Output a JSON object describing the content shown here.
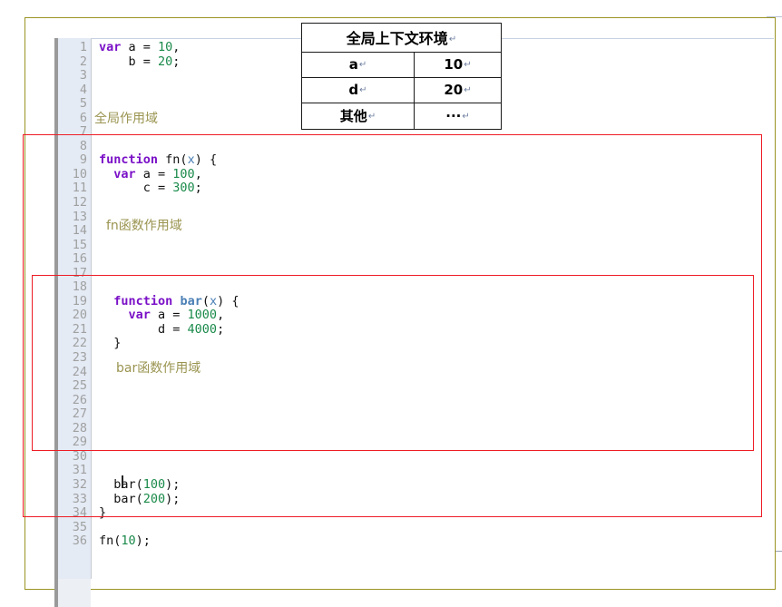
{
  "document": {
    "page_border_color": "#9a9424",
    "background": "#ffffff"
  },
  "editor": {
    "gutter": {
      "line_numbers": "1\n2\n3\n4\n5\n6\n7\n8\n9\n10\n11\n12\n13\n14\n15\n16\n17\n18\n19\n20\n21\n22\n23\n24\n25\n26\n27\n28\n29\n30\n31\n32\n33\n34\n35\n36",
      "first_line": 1,
      "last_line": 36,
      "background": "#e4ebf5",
      "text_color": "#a0a0a0"
    },
    "caret_line": 31,
    "syntax_colors": {
      "keyword": "#7a10c7",
      "number": "#1a8a4a",
      "function_name": "#4a7fb5",
      "parameter": "#4a7fb5",
      "plain": "#111111"
    },
    "lines": [
      {
        "n": 1,
        "tokens": [
          {
            "t": "var",
            "c": "kw"
          },
          {
            "t": " a = ",
            "c": "plain"
          },
          {
            "t": "10",
            "c": "num"
          },
          {
            "t": ",",
            "c": "plain"
          }
        ]
      },
      {
        "n": 2,
        "tokens": [
          {
            "t": "    b = ",
            "c": "plain"
          },
          {
            "t": "20",
            "c": "num"
          },
          {
            "t": ";",
            "c": "plain"
          }
        ]
      },
      {
        "n": 3,
        "tokens": []
      },
      {
        "n": 4,
        "tokens": []
      },
      {
        "n": 5,
        "tokens": []
      },
      {
        "n": 6,
        "tokens": []
      },
      {
        "n": 7,
        "tokens": []
      },
      {
        "n": 8,
        "tokens": []
      },
      {
        "n": 9,
        "tokens": [
          {
            "t": "function",
            "c": "kw"
          },
          {
            "t": " fn",
            "c": "plain"
          },
          {
            "t": "(",
            "c": "plain"
          },
          {
            "t": "x",
            "c": "param"
          },
          {
            "t": ") {",
            "c": "plain"
          }
        ]
      },
      {
        "n": 10,
        "tokens": [
          {
            "t": "  ",
            "c": "plain"
          },
          {
            "t": "var",
            "c": "kw"
          },
          {
            "t": " a = ",
            "c": "plain"
          },
          {
            "t": "100",
            "c": "num"
          },
          {
            "t": ",",
            "c": "plain"
          }
        ]
      },
      {
        "n": 11,
        "tokens": [
          {
            "t": "      c = ",
            "c": "plain"
          },
          {
            "t": "300",
            "c": "num"
          },
          {
            "t": ";",
            "c": "plain"
          }
        ]
      },
      {
        "n": 12,
        "tokens": []
      },
      {
        "n": 13,
        "tokens": []
      },
      {
        "n": 14,
        "tokens": []
      },
      {
        "n": 15,
        "tokens": []
      },
      {
        "n": 16,
        "tokens": []
      },
      {
        "n": 17,
        "tokens": []
      },
      {
        "n": 18,
        "tokens": []
      },
      {
        "n": 19,
        "tokens": [
          {
            "t": "  ",
            "c": "plain"
          },
          {
            "t": "function",
            "c": "kw"
          },
          {
            "t": " ",
            "c": "plain"
          },
          {
            "t": "bar",
            "c": "fnname"
          },
          {
            "t": "(",
            "c": "plain"
          },
          {
            "t": "x",
            "c": "param"
          },
          {
            "t": ") {",
            "c": "plain"
          }
        ]
      },
      {
        "n": 20,
        "tokens": [
          {
            "t": "    ",
            "c": "plain"
          },
          {
            "t": "var",
            "c": "kw"
          },
          {
            "t": " a = ",
            "c": "plain"
          },
          {
            "t": "1000",
            "c": "num"
          },
          {
            "t": ",",
            "c": "plain"
          }
        ]
      },
      {
        "n": 21,
        "tokens": [
          {
            "t": "        d = ",
            "c": "plain"
          },
          {
            "t": "4000",
            "c": "num"
          },
          {
            "t": ";",
            "c": "plain"
          }
        ]
      },
      {
        "n": 22,
        "tokens": [
          {
            "t": "  }",
            "c": "plain"
          }
        ]
      },
      {
        "n": 23,
        "tokens": []
      },
      {
        "n": 24,
        "tokens": []
      },
      {
        "n": 25,
        "tokens": []
      },
      {
        "n": 26,
        "tokens": []
      },
      {
        "n": 27,
        "tokens": []
      },
      {
        "n": 28,
        "tokens": []
      },
      {
        "n": 29,
        "tokens": []
      },
      {
        "n": 30,
        "tokens": []
      },
      {
        "n": 31,
        "tokens": []
      },
      {
        "n": 32,
        "tokens": [
          {
            "t": "  bar",
            "c": "plain"
          },
          {
            "t": "(",
            "c": "plain"
          },
          {
            "t": "100",
            "c": "num"
          },
          {
            "t": ");",
            "c": "plain"
          }
        ]
      },
      {
        "n": 33,
        "tokens": [
          {
            "t": "  bar",
            "c": "plain"
          },
          {
            "t": "(",
            "c": "plain"
          },
          {
            "t": "200",
            "c": "num"
          },
          {
            "t": ");",
            "c": "plain"
          }
        ]
      },
      {
        "n": 34,
        "tokens": [
          {
            "t": "}",
            "c": "plain"
          }
        ]
      },
      {
        "n": 35,
        "tokens": []
      },
      {
        "n": 36,
        "tokens": [
          {
            "t": "fn",
            "c": "plain"
          },
          {
            "t": "(",
            "c": "plain"
          },
          {
            "t": "10",
            "c": "num"
          },
          {
            "t": ");",
            "c": "plain"
          }
        ]
      }
    ]
  },
  "annotations": {
    "label_color": "#9a9450",
    "box_color": "#ee1c25",
    "global_scope_label": "全局作用域",
    "fn_scope_label": "fn函数作用域",
    "bar_scope_label": "bar函数作用域"
  },
  "context_table": {
    "header": "全局上下文环境",
    "pilcrow": "↵",
    "rows": [
      {
        "name": "a",
        "value": "10"
      },
      {
        "name": "d",
        "value": "20"
      },
      {
        "name": "其他",
        "value": "···"
      }
    ]
  }
}
